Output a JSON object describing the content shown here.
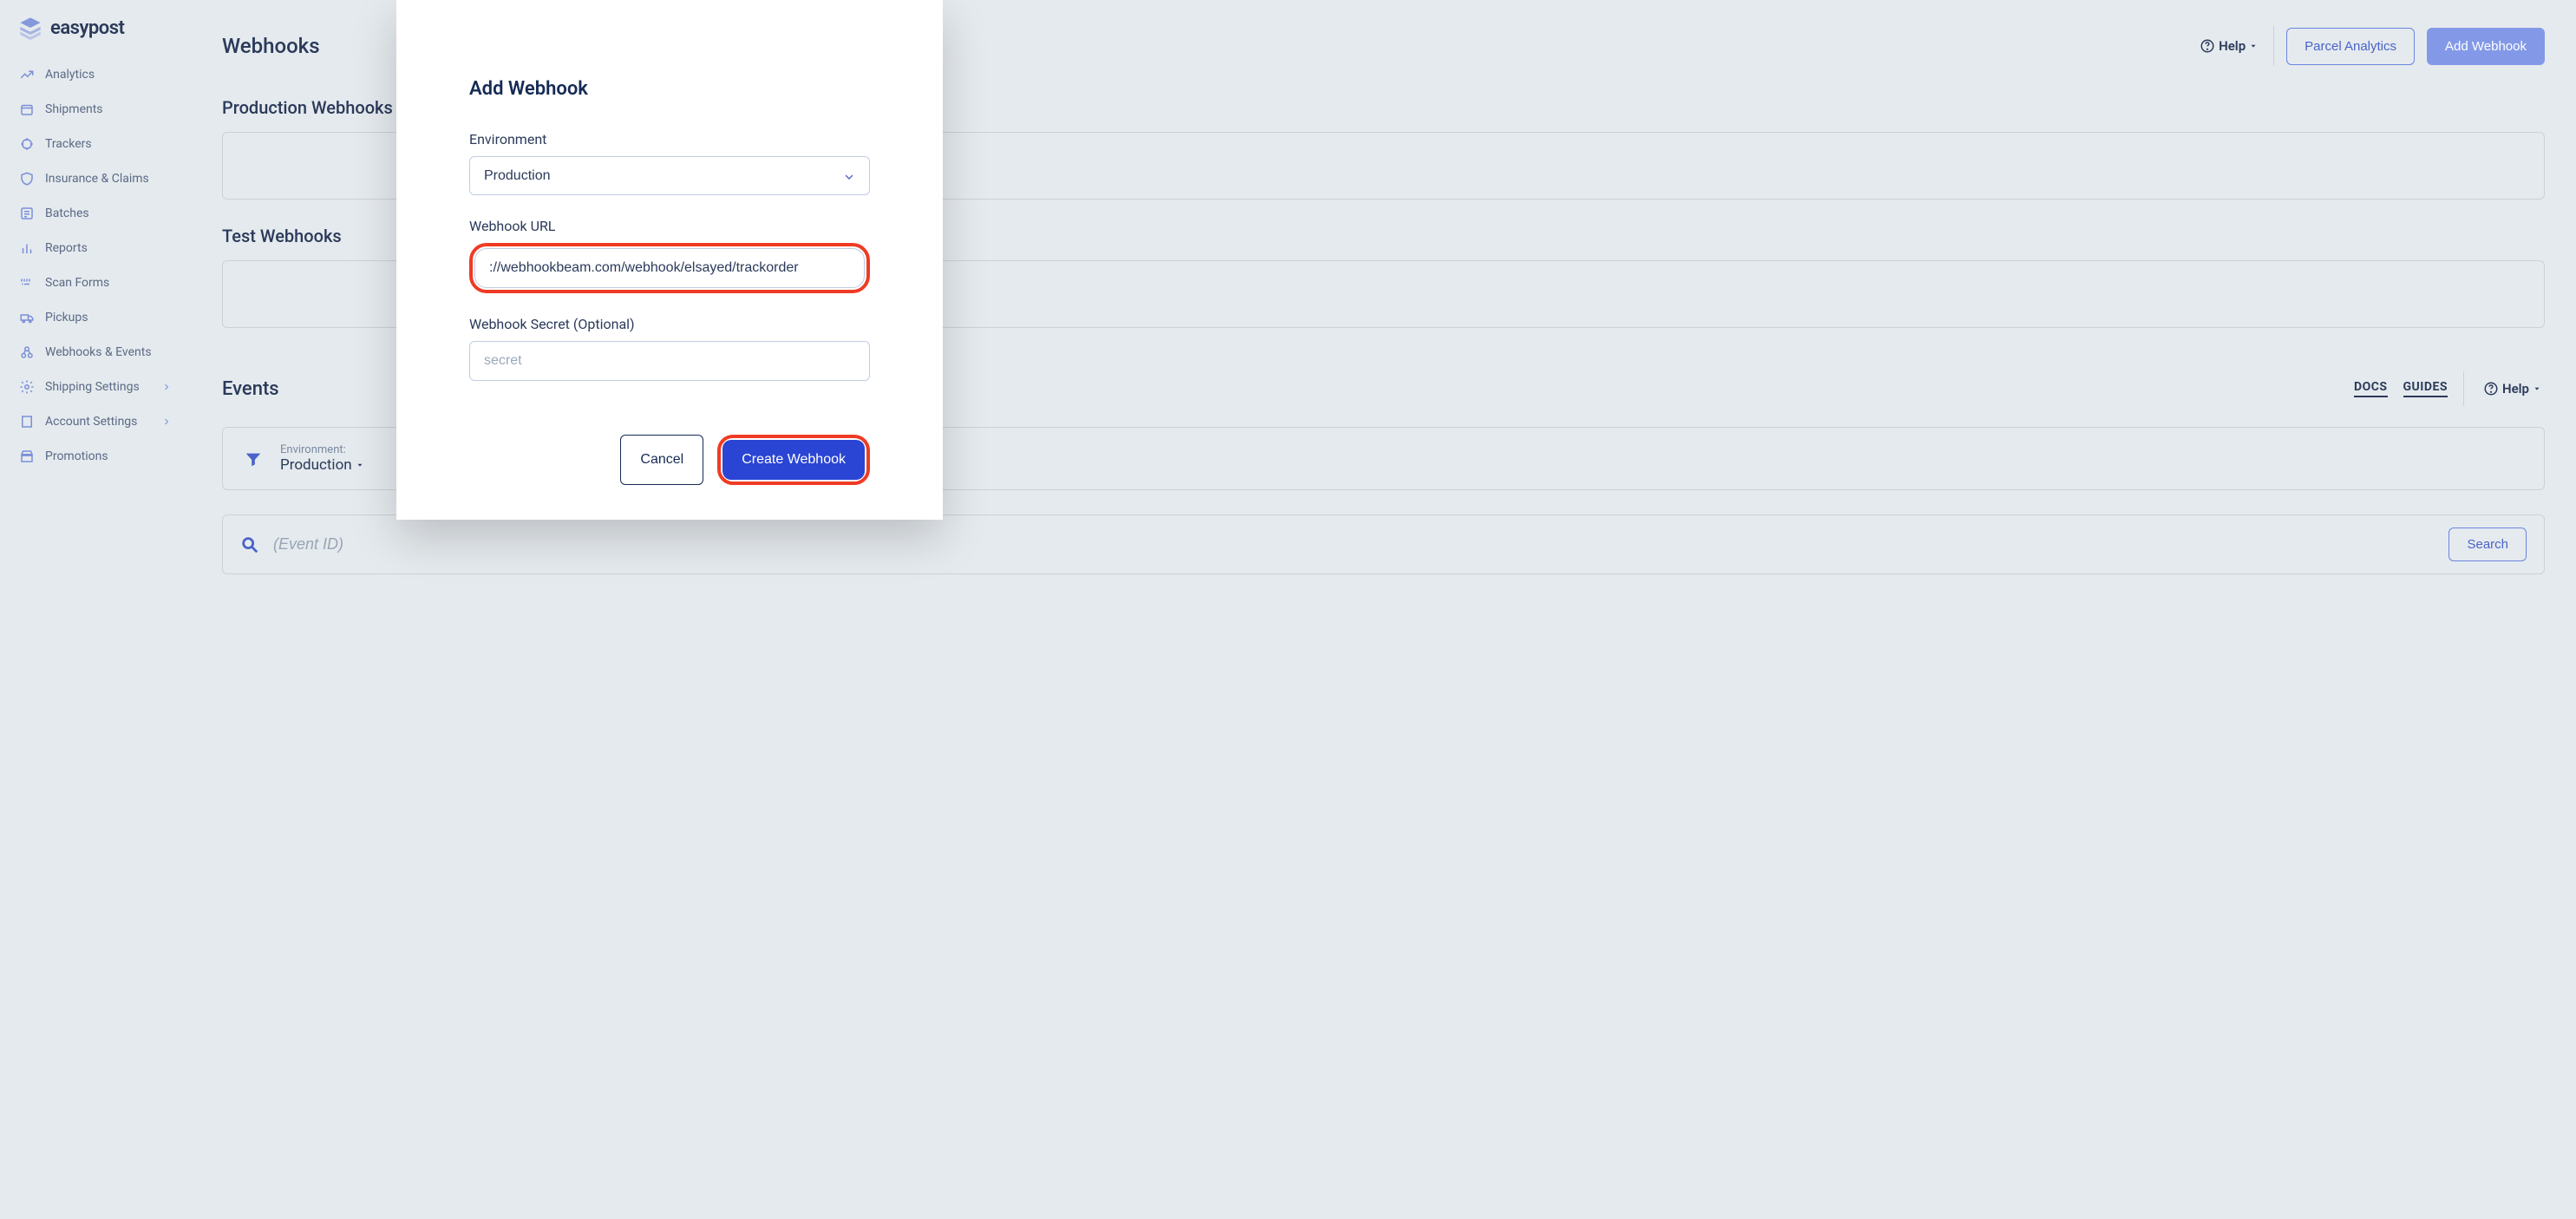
{
  "brand": {
    "name": "easypost"
  },
  "sidebar": {
    "items": [
      {
        "label": "Analytics"
      },
      {
        "label": "Shipments"
      },
      {
        "label": "Trackers"
      },
      {
        "label": "Insurance & Claims"
      },
      {
        "label": "Batches"
      },
      {
        "label": "Reports"
      },
      {
        "label": "Scan Forms"
      },
      {
        "label": "Pickups"
      },
      {
        "label": "Webhooks & Events"
      },
      {
        "label": "Shipping Settings"
      },
      {
        "label": "Account Settings"
      },
      {
        "label": "Promotions"
      }
    ]
  },
  "header": {
    "title": "Webhooks",
    "help": "Help",
    "parcel_analytics": "Parcel Analytics",
    "add_webhook": "Add Webhook"
  },
  "sections": {
    "production": "Production Webhooks",
    "test": "Test Webhooks",
    "events": "Events",
    "docs": "DOCS",
    "guides": "GUIDES",
    "help2": "Help"
  },
  "filter": {
    "label": "Environment:",
    "value": "Production"
  },
  "search": {
    "placeholder": "(Event ID)",
    "button": "Search"
  },
  "modal": {
    "title": "Add Webhook",
    "env_label": "Environment",
    "env_value": "Production",
    "url_label": "Webhook URL",
    "url_value": "://webhookbeam.com/webhook/elsayed/trackorder",
    "secret_label": "Webhook Secret (Optional)",
    "secret_placeholder": "secret",
    "cancel": "Cancel",
    "create": "Create Webhook"
  }
}
